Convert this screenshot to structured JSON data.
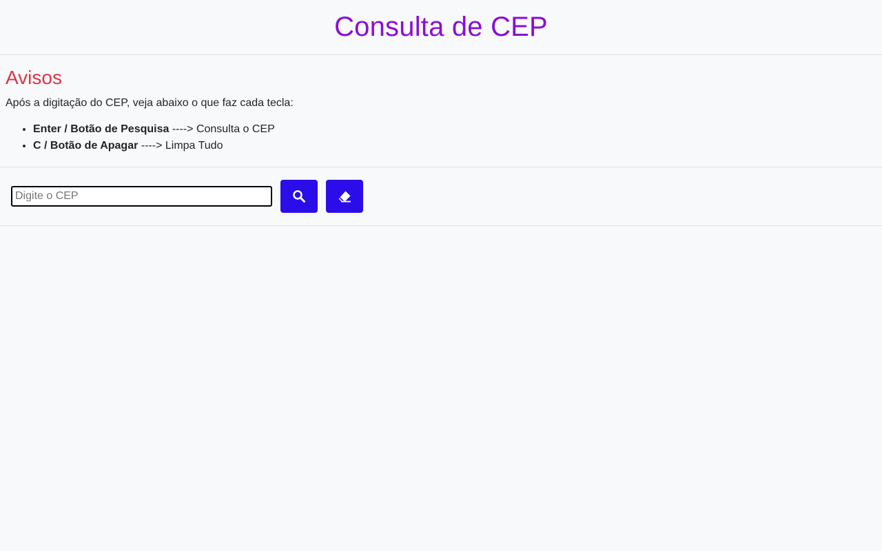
{
  "header": {
    "title": "Consulta de CEP",
    "title_color": "#8a0ed6"
  },
  "avisos": {
    "heading": "Avisos",
    "heading_color": "#dc3545",
    "intro": "Após a digitação do CEP, veja abaixo o que faz cada tecla:",
    "items": [
      {
        "key": "Enter / Botão de Pesquisa",
        "action": " ----> Consulta o CEP"
      },
      {
        "key": "C / Botão de Apagar",
        "action": " ----> Limpa Tudo"
      }
    ]
  },
  "search": {
    "input_value": "",
    "input_placeholder": "Digite o CEP",
    "search_button_icon": "search-icon",
    "clear_button_icon": "eraser-icon",
    "button_color": "#2a0de8"
  }
}
